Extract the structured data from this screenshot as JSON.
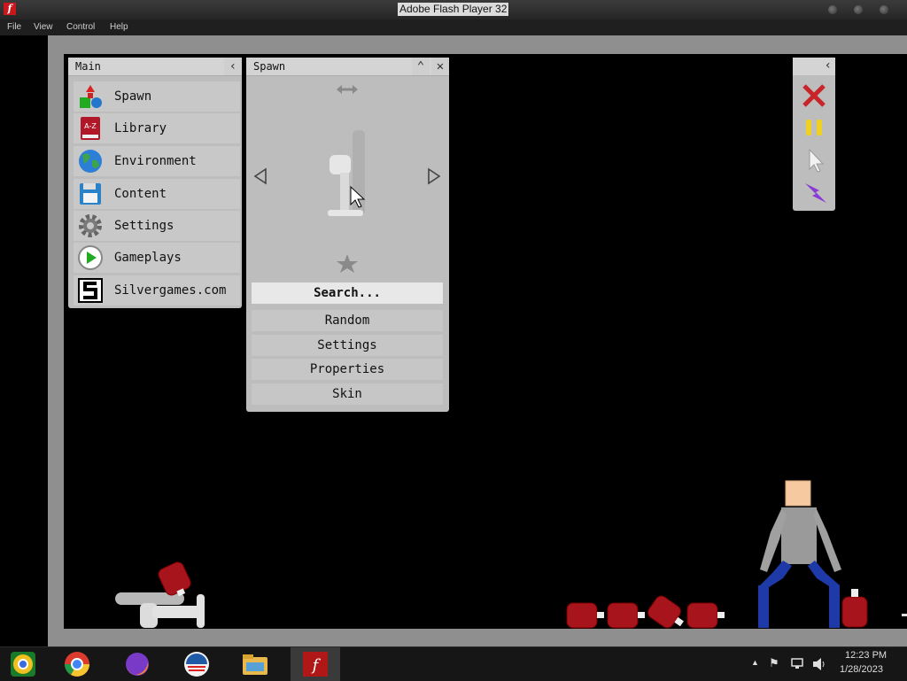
{
  "window": {
    "title": "Adobe Flash Player 32"
  },
  "menubar": {
    "items": [
      "File",
      "View",
      "Control",
      "Help"
    ]
  },
  "main_panel": {
    "title": "Main",
    "items": [
      {
        "label": "Spawn",
        "icon": "shapes-icon"
      },
      {
        "label": "Library",
        "icon": "book-icon"
      },
      {
        "label": "Environment",
        "icon": "globe-icon"
      },
      {
        "label": "Content",
        "icon": "floppy-disk-icon"
      },
      {
        "label": "Settings",
        "icon": "gear-icon"
      },
      {
        "label": "Gameplays",
        "icon": "play-icon"
      },
      {
        "label": "Silvergames.com",
        "icon": "silvergames-logo-icon"
      }
    ]
  },
  "spawn_panel": {
    "title": "Spawn",
    "search_label": "Search...",
    "buttons": [
      "Random",
      "Settings",
      "Properties",
      "Skin"
    ]
  },
  "taskbar": {
    "time": "12:23 PM",
    "date": "1/28/2023"
  },
  "colors": {
    "panel_bg": "#bdbdbd",
    "canister_red": "#a8141c",
    "ragdoll_shirt": "#9a9a9a",
    "ragdoll_pants": "#1e3aa8",
    "ragdoll_head": "#f6c9a0"
  }
}
